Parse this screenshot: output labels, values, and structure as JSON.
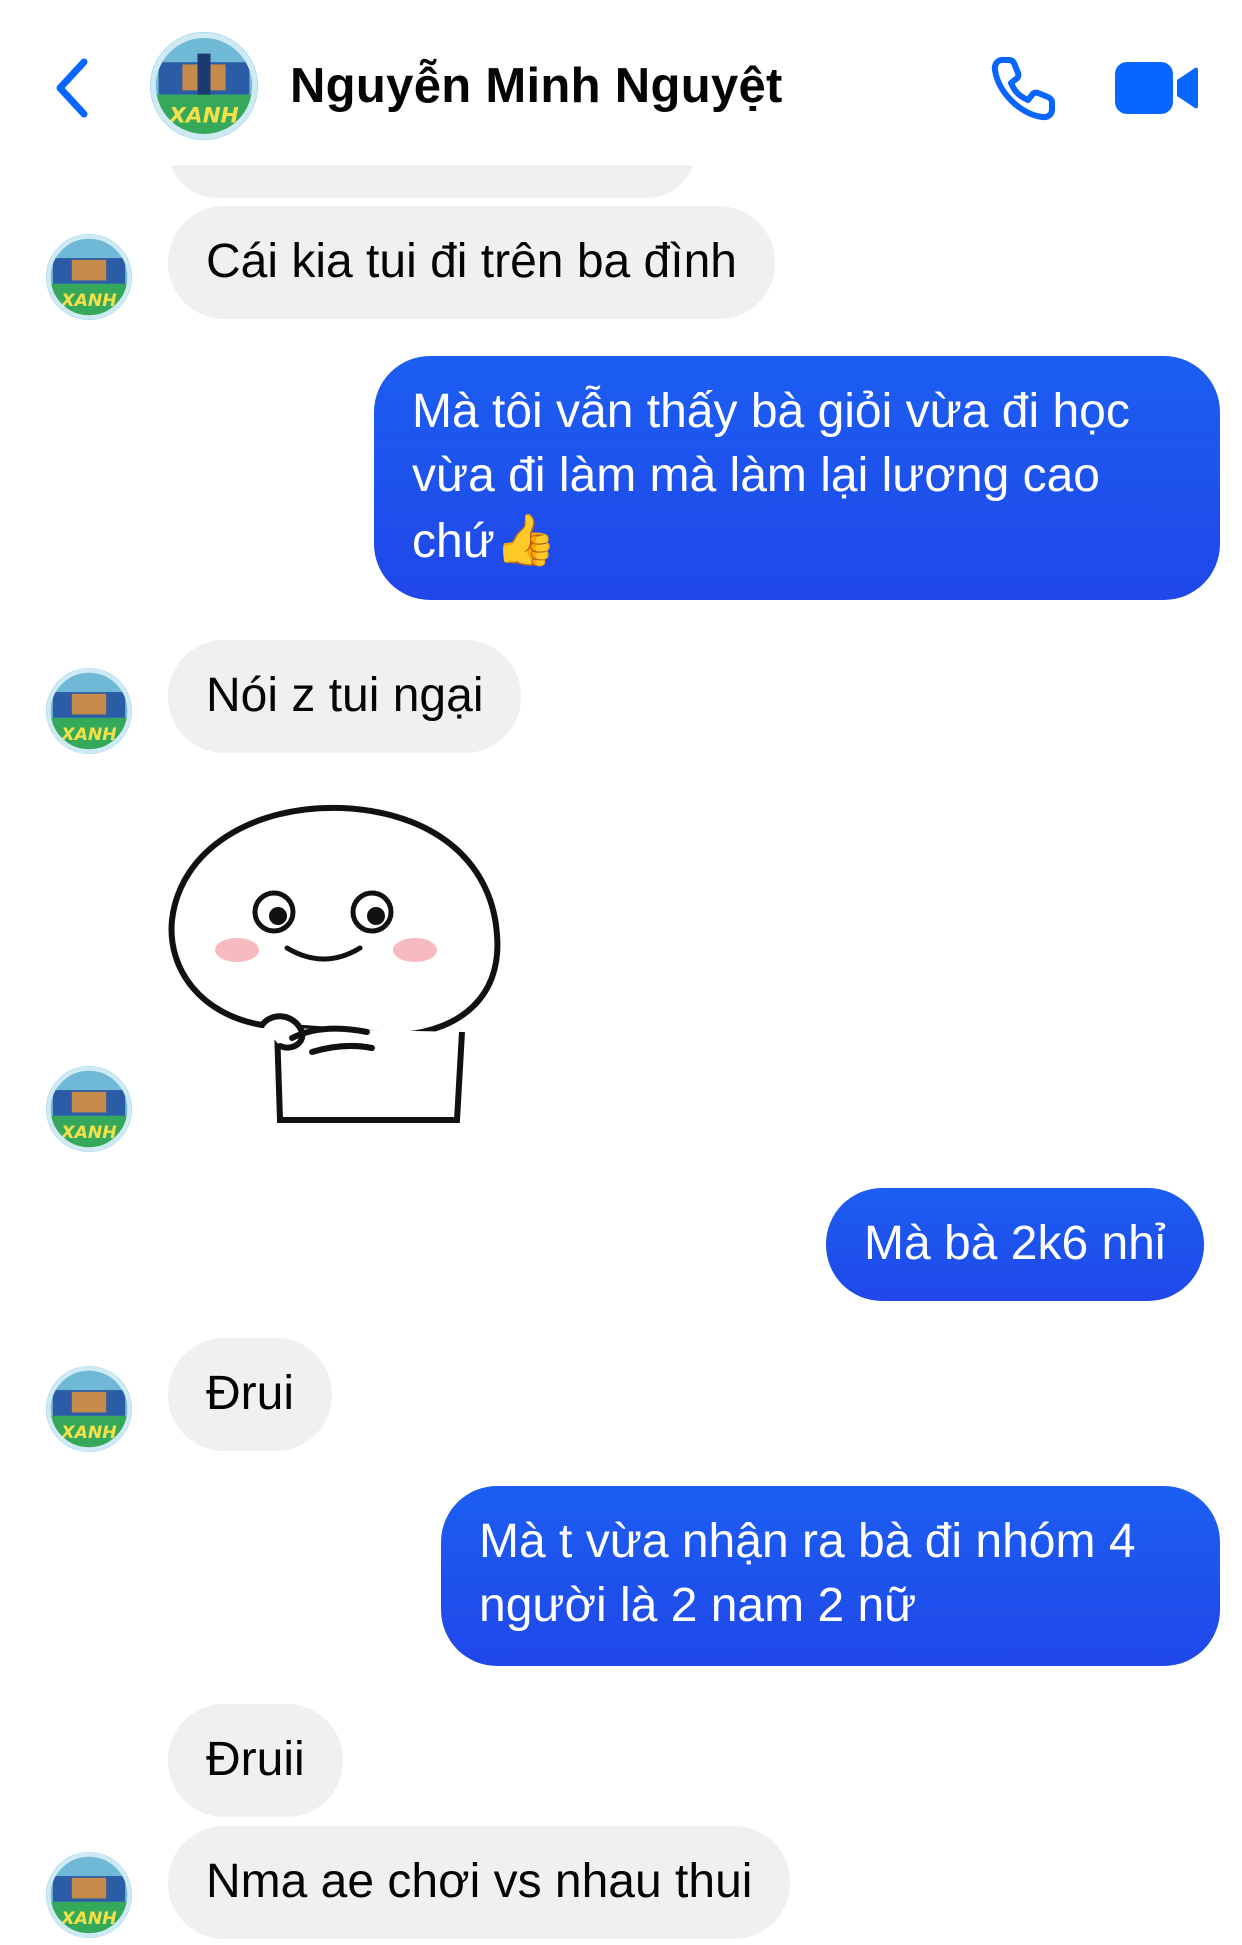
{
  "header": {
    "contact_name": "Nguyễn Minh Nguyệt",
    "back_icon": "chevron-left-icon",
    "call_icon": "phone-icon",
    "video_icon": "video-camera-icon",
    "accent_color": "#0866ff"
  },
  "messages": [
    {
      "side": "incoming",
      "type": "text",
      "text": "Cái kia tui đi trên ba đình"
    },
    {
      "side": "outgoing",
      "type": "text",
      "text": "Mà tôi vẫn thấy bà giỏi vừa đi học vừa đi làm mà làm lại lương cao chứ",
      "emoji": "👍"
    },
    {
      "side": "incoming",
      "type": "text",
      "text": "Nói z tui ngại"
    },
    {
      "side": "incoming",
      "type": "sticker",
      "sticker": "white-blob-character-sticker"
    },
    {
      "side": "outgoing",
      "type": "text",
      "text": "Mà bà 2k6 nhỉ"
    },
    {
      "side": "incoming",
      "type": "text",
      "text": "Đrui"
    },
    {
      "side": "outgoing",
      "type": "text",
      "text": "Mà t vừa nhận ra bà đi nhóm 4 người là 2 nam 2 nữ"
    },
    {
      "side": "incoming",
      "type": "text",
      "text": "Đruii"
    },
    {
      "side": "incoming",
      "type": "text",
      "text": "Nma ae chơi vs nhau thui"
    }
  ],
  "colors": {
    "incoming_bubble": "#f0f0f0",
    "outgoing_bubble": "#1f52ee",
    "text_dark": "#050505"
  }
}
